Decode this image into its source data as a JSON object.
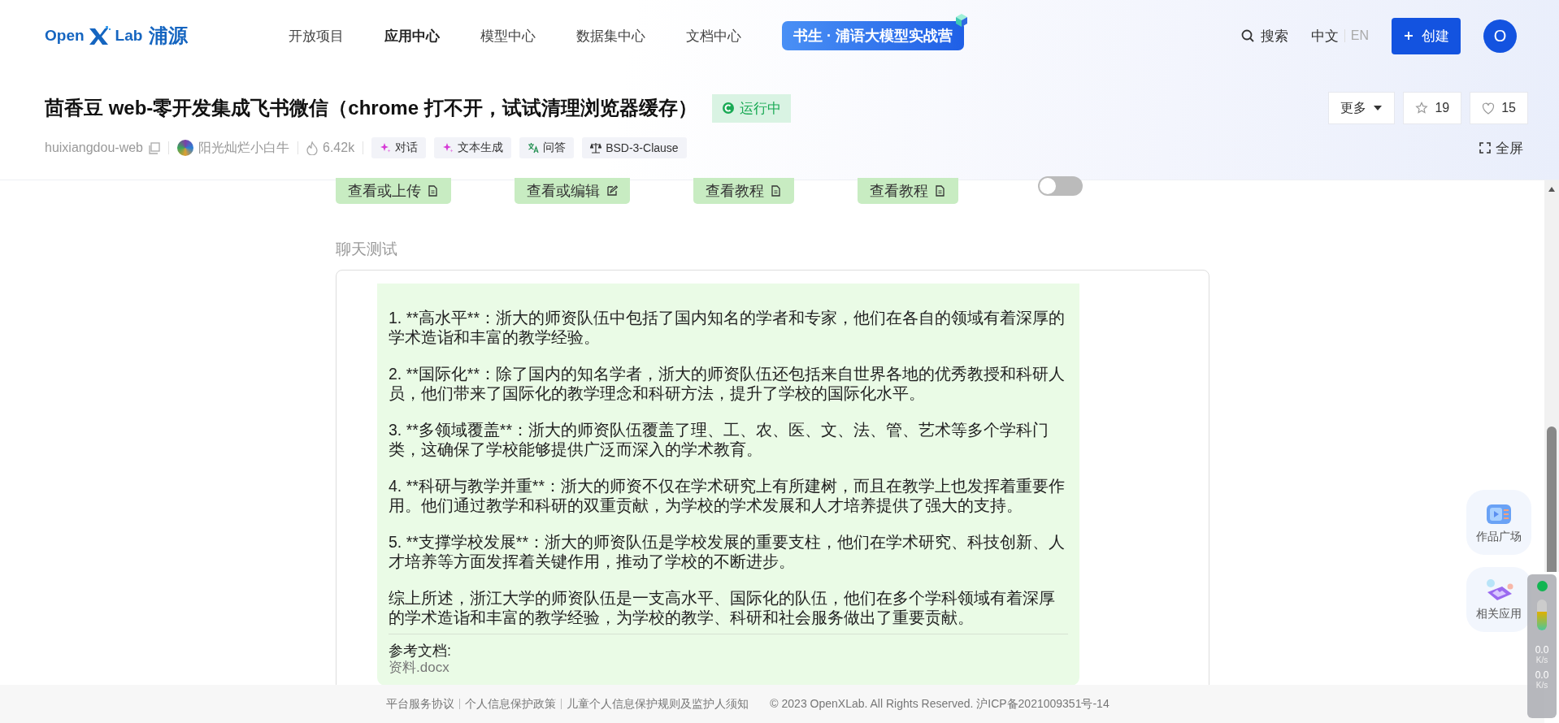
{
  "nav": {
    "logo_latin": "Open",
    "logo_lab": "Lab",
    "logo_cn": "浦源",
    "items": [
      {
        "label": "开放项目",
        "selected": false
      },
      {
        "label": "应用中心",
        "selected": true
      },
      {
        "label": "模型中心",
        "selected": false
      },
      {
        "label": "数据集中心",
        "selected": false
      },
      {
        "label": "文档中心",
        "selected": false
      }
    ],
    "banner": "书生 · 浦语大模型实战营",
    "search": "搜索",
    "languages": [
      {
        "label": "中文",
        "selected": true
      },
      {
        "label": "EN",
        "selected": false
      }
    ],
    "create_button": "创建",
    "avatar": "O"
  },
  "project": {
    "title": "茴香豆 web-零开发集成飞书微信（chrome 打不开，试试清理浏览器缓存）",
    "status": "运行中",
    "more": "更多",
    "stars": "19",
    "likes": "15",
    "fullscreen": "全屏",
    "repo": "huixiangdou-web",
    "author": "阳光灿烂小白牛",
    "views": "6.42k",
    "tags": [
      {
        "label": "对话",
        "kind": "sparkle"
      },
      {
        "label": "文本生成",
        "kind": "sparkle"
      },
      {
        "label": "问答",
        "kind": "translate"
      },
      {
        "label": "BSD-3-Clause",
        "kind": "license"
      }
    ]
  },
  "toolbar": {
    "buttons": [
      {
        "label": "查看或上传",
        "kind": "file"
      },
      {
        "label": "查看或编辑",
        "kind": "edit"
      },
      {
        "label": "查看教程",
        "kind": "file"
      },
      {
        "label": "查看教程",
        "kind": "file"
      }
    ],
    "toggle": {
      "on": false
    }
  },
  "chat": {
    "section_title": "聊天测试",
    "paragraphs": [
      "1. **高水平**：浙大的师资队伍中包括了国内知名的学者和专家，他们在各自的领域有着深厚的学术造诣和丰富的教学经验。",
      "2. **国际化**：除了国内的知名学者，浙大的师资队伍还包括来自世界各地的优秀教授和科研人员，他们带来了国际化的教学理念和科研方法，提升了学校的国际化水平。",
      "3. **多领域覆盖**：浙大的师资队伍覆盖了理、工、农、医、文、法、管、艺术等多个学科门类，这确保了学校能够提供广泛而深入的学术教育。",
      "4. **科研与教学并重**：浙大的师资不仅在学术研究上有所建树，而且在教学上也发挥着重要作用。他们通过教学和科研的双重贡献，为学校的学术发展和人才培养提供了强大的支持。",
      "5. **支撑学校发展**：浙大的师资队伍是学校发展的重要支柱，他们在学术研究、科技创新、人才培养等方面发挥着关键作用，推动了学校的不断进步。",
      "综上所述，浙江大学的师资队伍是一支高水平、国际化的队伍，他们在多个学科领域有着深厚的学术造诣和丰富的教学经验，为学校的教学、科研和社会服务做出了重要贡献。"
    ],
    "references_label": "参考文档:",
    "reference_file": "资料.docx"
  },
  "floating": [
    {
      "label": "作品广场",
      "kind": "tv"
    },
    {
      "label": "相关应用",
      "kind": "image"
    }
  ],
  "footer": {
    "links": [
      "平台服务协议",
      "个人信息保护政策",
      "儿童个人信息保护规则及监护人须知"
    ],
    "copyright": "© 2023 OpenXLab. All Rights Reserved. 沪ICP备2021009351号-14"
  },
  "net_monitor": {
    "level": 0.6,
    "upload": "0.0",
    "upload_unit": "K/s",
    "download": "0.0",
    "download_unit": "K/s"
  }
}
